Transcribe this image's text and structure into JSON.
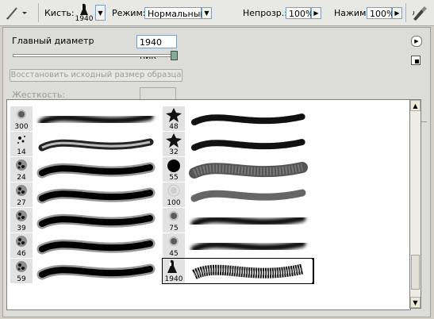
{
  "toolbar": {
    "brush_label": "Кисть:",
    "brush_size": "1940",
    "mode_label": "Режим:",
    "mode_value": "Нормальный",
    "opacity_label": "Непрозр.:",
    "opacity_value": "100%",
    "pressure_label": "Нажим:",
    "pressure_value": "100%"
  },
  "panel": {
    "master_diameter_label": "Главный диаметр",
    "master_diameter_value": "1940 пик",
    "restore_button": "Восстановить исходный размер образца",
    "hardness_label": "Жесткость:"
  },
  "brushes": {
    "left": [
      {
        "size": "300",
        "thumb": "soft-round"
      },
      {
        "size": "14",
        "thumb": "splatter"
      },
      {
        "size": "24",
        "thumb": "chalk"
      },
      {
        "size": "27",
        "thumb": "chalk"
      },
      {
        "size": "39",
        "thumb": "chalk"
      },
      {
        "size": "46",
        "thumb": "chalk"
      },
      {
        "size": "59",
        "thumb": "chalk"
      }
    ],
    "right": [
      {
        "size": "48",
        "thumb": "star"
      },
      {
        "size": "32",
        "thumb": "star"
      },
      {
        "size": "55",
        "thumb": "hard-round"
      },
      {
        "size": "100",
        "thumb": "dune-grass"
      },
      {
        "size": "75",
        "thumb": "soft-round"
      },
      {
        "size": "45",
        "thumb": "soft-round"
      },
      {
        "size": "1940",
        "thumb": "sampled-figure",
        "selected": true
      }
    ]
  }
}
